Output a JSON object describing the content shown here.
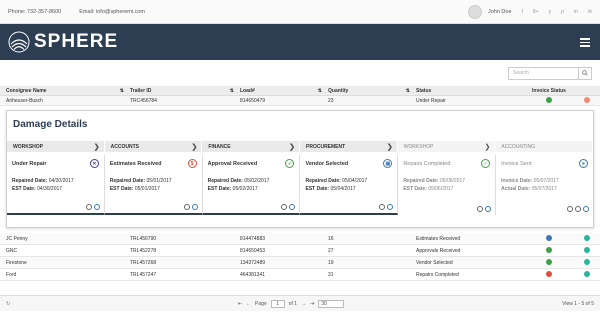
{
  "topbar": {
    "phone": "Phone: 732-357-8600",
    "email": "Email: info@spheremi.com",
    "user_name": "John Doe",
    "social": [
      "f",
      "8+",
      "y",
      "p",
      "in",
      "✉"
    ]
  },
  "brand": {
    "name": "SPHERE"
  },
  "search": {
    "placeholder": "Search"
  },
  "columns": [
    "Consignee Name",
    "Trailer ID",
    "Load#",
    "Quantity",
    "Status",
    "Invoice Status"
  ],
  "expanded_row": {
    "consignee": "Anheuser-Busch",
    "trailer": "TRC456784",
    "load": "814650479",
    "quantity": "23",
    "status": "Under Repair"
  },
  "details": {
    "title": "Damage Details",
    "steps": [
      "WORKSHOP",
      "ACCOUNTS",
      "FINANCE",
      "PROCUREMENT",
      "WORKSHOP",
      "ACCOUNTING"
    ],
    "cards": [
      {
        "title": "Under Repair",
        "l1": "Repaired Date:",
        "v1": "04/30/2017",
        "l2": "EST Date:",
        "v2": "04/30/2017",
        "icon": "wrench-icon",
        "color": "#4a3a9a"
      },
      {
        "title": "Estimates Received",
        "l1": "Repaired Date:",
        "v1": "05/01/2017",
        "l2": "EST Date:",
        "v2": "05/01/2017",
        "icon": "dollar-icon",
        "color": "#e04b3c"
      },
      {
        "title": "Approval Received",
        "l1": "Repaired Date:",
        "v1": "05/02/2017",
        "l2": "EST Date:",
        "v2": "05/02/2017",
        "icon": "check-icon",
        "color": "#3aa145"
      },
      {
        "title": "Vendor Selected",
        "l1": "Repaired Date:",
        "v1": "05/04/2017",
        "l2": "EST Date:",
        "v2": "05/04/2017",
        "icon": "vendor-icon",
        "color": "#3a78b8"
      },
      {
        "title": "Repairs Completed",
        "l1": "Repaired Date:",
        "v1": "05/06/2017",
        "l2": "EST Date:",
        "v2": "05/06/2017",
        "icon": "check-icon",
        "color": "#3aa145"
      },
      {
        "title": "Invoice Sent",
        "l1": "Invoice Date:",
        "v1": "05/07/2017",
        "l2": "Actual Date:",
        "v2": "05/07/2017",
        "icon": "send-icon",
        "color": "#3a78b8"
      }
    ]
  },
  "rows": [
    {
      "consignee": "JC Penny",
      "trailer": "TRL456790",
      "load": "814474883",
      "quantity": "16",
      "status": "Estimates Received"
    },
    {
      "consignee": "GNC",
      "trailer": "TRL452278",
      "load": "814650453",
      "quantity": "27",
      "status": "Approvals Received"
    },
    {
      "consignee": "Firestone",
      "trailer": "TRL457268",
      "load": "134372489",
      "quantity": "19",
      "status": "Vendor Selected"
    },
    {
      "consignee": "Ford",
      "trailer": "TRL457247",
      "load": "464381341",
      "quantity": "31",
      "status": "Repairs Completed"
    }
  ],
  "pager": {
    "page_label": "Page",
    "page": "1",
    "of_label": "of 1",
    "per_page": "30",
    "summary": "View 1 - 5 of 5"
  }
}
